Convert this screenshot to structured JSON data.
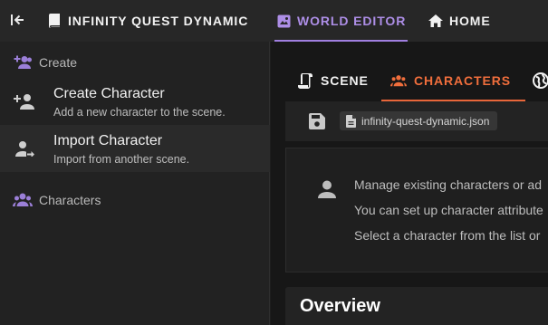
{
  "colors": {
    "accent_purple": "#ad8ee6",
    "accent_orange": "#f06e3c",
    "app_bar": "#272727",
    "drawer": "#222222",
    "main_bg": "#171717"
  },
  "topbar": {
    "collapse_icon": "collapse-left-icon",
    "tabs": [
      {
        "label": "INFINITY QUEST DYNAMIC",
        "icon": "book-icon",
        "active": false
      },
      {
        "label": "WORLD EDITOR",
        "icon": "world-map-icon",
        "active": true
      },
      {
        "label": "HOME",
        "icon": "home-icon",
        "active": false
      }
    ]
  },
  "drawer": {
    "create_section": {
      "label": "Create",
      "icon": "group-add-icon"
    },
    "items": [
      {
        "title": "Create Character",
        "subtitle": "Add a new character to the scene.",
        "icon": "person-add-icon"
      },
      {
        "title": "Import Character",
        "subtitle": "Import from another scene.",
        "icon": "person-import-icon"
      }
    ],
    "characters_section": {
      "label": "Characters",
      "icon": "group-icon"
    }
  },
  "main": {
    "tabs": [
      {
        "label": "SCENE",
        "icon": "scroll-icon",
        "active": false
      },
      {
        "label": "CHARACTERS",
        "icon": "groups-icon",
        "active": true
      },
      {
        "label": "",
        "icon": "globe-icon",
        "active": false
      }
    ],
    "file": {
      "name": "infinity-quest-dynamic.json",
      "save_icon": "save-icon",
      "file_icon": "file-icon"
    },
    "info": {
      "icon": "person-icon",
      "lines": [
        "Manage existing characters or ad",
        "You can set up character attribute",
        "Select a character from the list or"
      ]
    },
    "overview_title": "Overview"
  }
}
